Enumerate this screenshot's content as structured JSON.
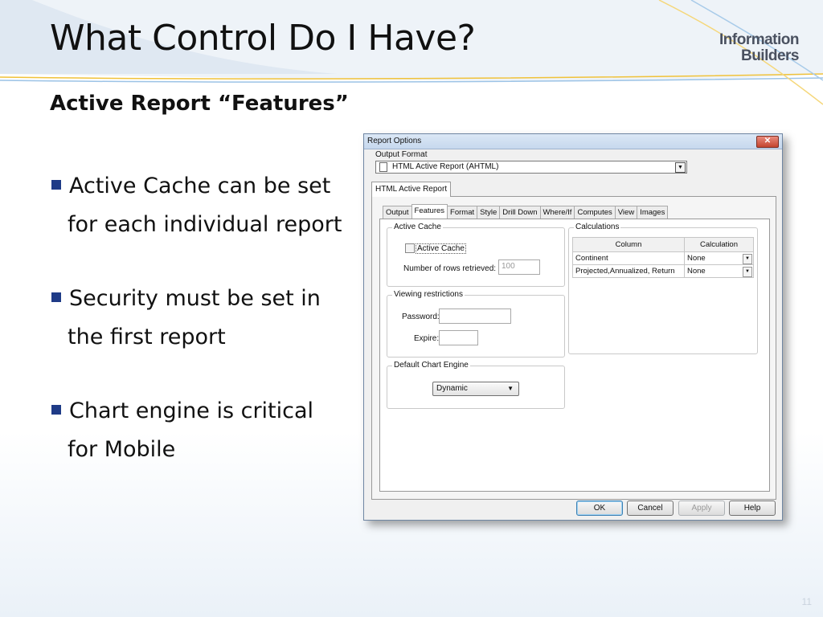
{
  "slide": {
    "title": "What Control Do I Have?",
    "subtitle": "Active Report “Features”",
    "logo_line1": "Information",
    "logo_line2": "Builders",
    "page_number": "11",
    "bullets": [
      {
        "line1": "Active Cache can be set",
        "line2": "for each individual report"
      },
      {
        "line1": "Security must be set in",
        "line2": "the first report"
      },
      {
        "line1": "Chart engine is critical",
        "line2": "for Mobile"
      }
    ]
  },
  "dialog": {
    "title": "Report Options",
    "close_label": "✕",
    "output_format_label": "Output Format",
    "output_format_value": "HTML Active Report (AHTML)",
    "outer_tab": "HTML Active Report",
    "tabs": [
      "Output",
      "Features",
      "Format",
      "Style",
      "Drill Down",
      "Where/If",
      "Computes",
      "View",
      "Images"
    ],
    "active_cache": {
      "group_title": "Active Cache",
      "checkbox_label": "Active Cache",
      "rows_label": "Number of rows retrieved:",
      "rows_value": "100"
    },
    "viewing": {
      "group_title": "Viewing restrictions",
      "password_label": "Password:",
      "expire_label": "Expire:"
    },
    "chart_engine": {
      "group_title": "Default Chart Engine",
      "value": "Dynamic"
    },
    "calculations": {
      "group_title": "Calculations",
      "headers": [
        "Column",
        "Calculation"
      ],
      "rows": [
        {
          "column": "Continent",
          "calc": "None"
        },
        {
          "column": "Projected,Annualized,   Return",
          "calc": "None"
        }
      ]
    },
    "buttons": {
      "ok": "OK",
      "cancel": "Cancel",
      "apply": "Apply",
      "help": "Help"
    }
  }
}
